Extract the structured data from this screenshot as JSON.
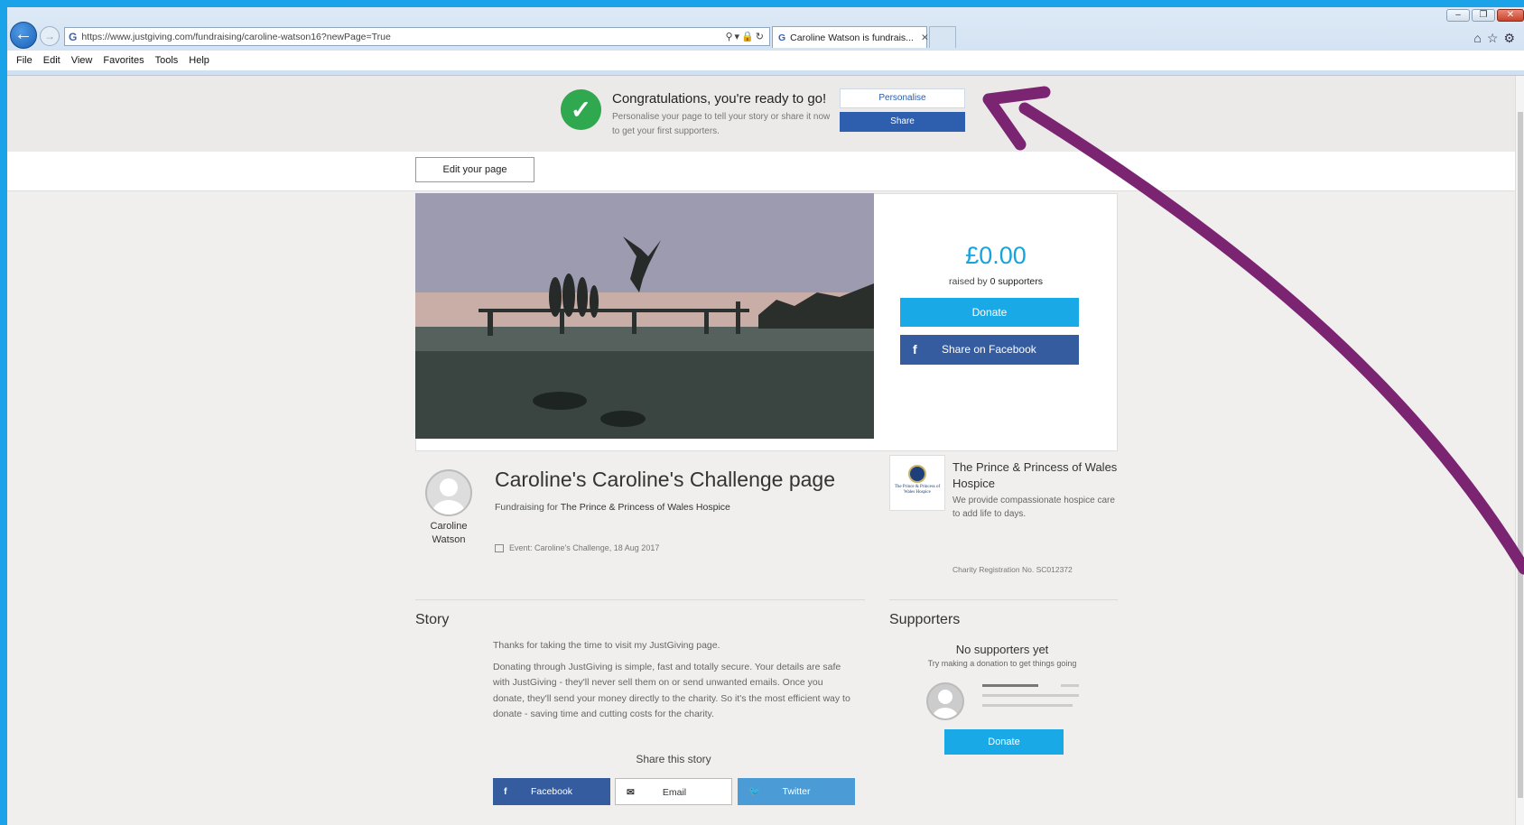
{
  "browser": {
    "url": "https://www.justgiving.com/fundraising/caroline-watson16?newPage=True",
    "tab_title": "Caroline Watson is fundrais...",
    "menu": [
      "File",
      "Edit",
      "View",
      "Favorites",
      "Tools",
      "Help"
    ]
  },
  "banner": {
    "title": "Congratulations, you're ready to go!",
    "subtitle": "Personalise your page to tell your story or share it now to get your first supporters.",
    "personalise_label": "Personalise",
    "share_label": "Share"
  },
  "edit_label": "Edit your page",
  "donation": {
    "amount": "£0.00",
    "raised_prefix": "raised by ",
    "supporters_count": "0 supporters",
    "donate_label": "Donate",
    "facebook_label": "Share on Facebook"
  },
  "owner": {
    "first": "Caroline",
    "last": "Watson"
  },
  "page_title": "Caroline's Caroline's Challenge page",
  "fundraising_prefix": "Fundraising for ",
  "charity_name_short": "The Prince & Princess of Wales Hospice",
  "event": "Event: Caroline's Challenge, 18 Aug 2017",
  "charity": {
    "name": "The Prince & Princess of Wales Hospice",
    "description": "We provide compassionate hospice care to add life to days.",
    "registration": "Charity Registration No. SC012372",
    "logo_text": "The Prince & Princess of Wales Hospice"
  },
  "story": {
    "heading": "Story",
    "p1": "Thanks for taking the time to visit my JustGiving page.",
    "p2": "Donating through JustGiving is simple, fast and totally secure. Your details are safe with JustGiving - they'll never sell them on or send unwanted emails. Once you donate, they'll send your money directly to the charity. So it's the most efficient way to donate - saving time and cutting costs for the charity.",
    "share_title": "Share this story",
    "share_buttons": {
      "facebook": "Facebook",
      "email": "Email",
      "twitter": "Twitter"
    }
  },
  "supporters": {
    "heading": "Supporters",
    "empty_title": "No supporters yet",
    "empty_sub": "Try making a donation to get things going",
    "donate_label": "Donate"
  },
  "colors": {
    "accent_blue": "#19a9e6",
    "facebook_blue": "#355c9f",
    "success_green": "#2fa84f",
    "annotation_arrow": "#7a2472",
    "outer_frame": "#1aa3e8"
  }
}
